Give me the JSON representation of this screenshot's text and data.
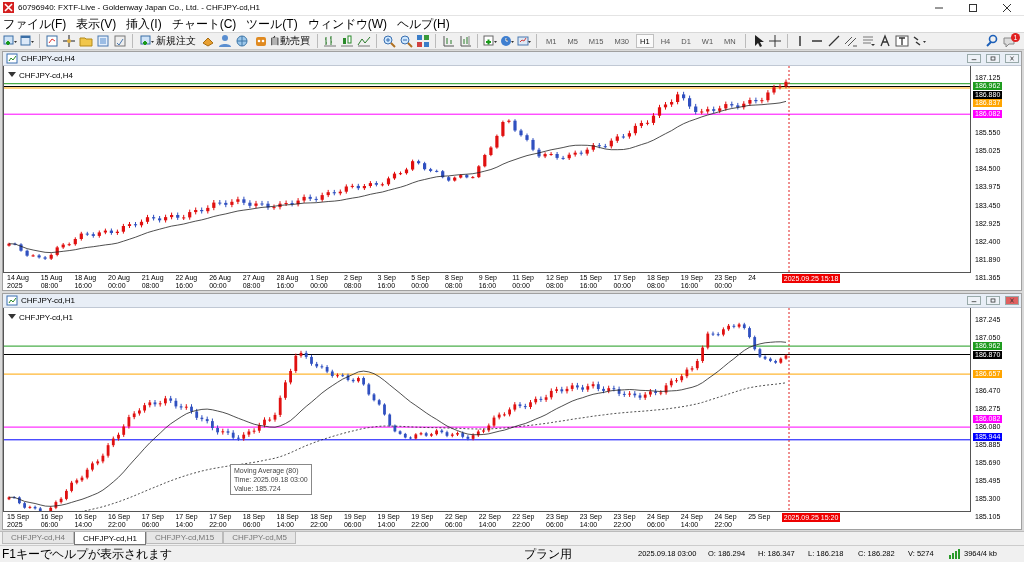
{
  "window": {
    "title": "60796940: FXTF-Live - Goldenway Japan Co., Ltd. - CHFJPY-cd,H1"
  },
  "menu": [
    "ファイル(F)",
    "表示(V)",
    "挿入(I)",
    "チャート(C)",
    "ツール(T)",
    "ウィンドウ(W)",
    "ヘルプ(H)"
  ],
  "toolbar": {
    "order_button": "新規注文",
    "autotrade_button": "自動売買",
    "notification_count": "1",
    "timeframes": [
      {
        "label": "M1",
        "selected": false
      },
      {
        "label": "M5",
        "selected": false
      },
      {
        "label": "M15",
        "selected": false
      },
      {
        "label": "M30",
        "selected": false
      },
      {
        "label": "H1",
        "selected": true
      },
      {
        "label": "H4",
        "selected": false
      },
      {
        "label": "D1",
        "selected": false
      },
      {
        "label": "W1",
        "selected": false
      },
      {
        "label": "MN",
        "selected": false
      }
    ]
  },
  "charts": [
    {
      "title": "CHFJPY-cd,H4",
      "symbol_label": "CHFJPY-cd,H4",
      "price_ticks": [
        "187.125",
        "185.550",
        "185.025",
        "184.500",
        "183.975",
        "183.450",
        "182.925",
        "182.400",
        "181.890",
        "181.365"
      ],
      "price_tags": [
        {
          "text": "186.962",
          "color": "#1e9b1e"
        },
        {
          "text": "186.880",
          "color": "#000000"
        },
        {
          "text": "186.837",
          "color": "#ffa500"
        },
        {
          "text": "186.082",
          "color": "#ff00ff"
        }
      ],
      "time_labels": [
        "14 Aug 2025",
        "15 Aug 08:00",
        "18 Aug 16:00",
        "20 Aug 00:00",
        "21 Aug 08:00",
        "22 Aug 16:00",
        "26 Aug 00:00",
        "27 Aug 08:00",
        "28 Aug 16:00",
        "1 Sep 00:00",
        "2 Sep 08:00",
        "3 Sep 16:00",
        "5 Sep 00:00",
        "8 Sep 08:00",
        "9 Sep 16:00",
        "11 Sep 00:00",
        "12 Sep 08:00",
        "15 Sep 16:00",
        "17 Sep 00:00",
        "18 Sep 08:00",
        "19 Sep 16:00",
        "23 Sep 00:00",
        "24"
      ],
      "time_marker": "2025.09.25 15:18"
    },
    {
      "title": "CHFJPY-cd,H1",
      "symbol_label": "CHFJPY-cd,H1",
      "price_ticks": [
        "187.245",
        "187.050",
        "186.470",
        "186.275",
        "186.080",
        "185.885",
        "185.690",
        "185.495",
        "185.300",
        "185.105"
      ],
      "price_tags": [
        {
          "text": "186.962",
          "color": "#1e9b1e"
        },
        {
          "text": "186.870",
          "color": "#000000"
        },
        {
          "text": "186.657",
          "color": "#ffa500"
        },
        {
          "text": "186.082",
          "color": "#ff00ff"
        },
        {
          "text": "185.944",
          "color": "#0000ff"
        }
      ],
      "time_labels": [
        "15 Sep 2025",
        "16 Sep 06:00",
        "16 Sep 14:00",
        "16 Sep 22:00",
        "17 Sep 06:00",
        "17 Sep 14:00",
        "17 Sep 22:00",
        "18 Sep 06:00",
        "18 Sep 14:00",
        "18 Sep 22:00",
        "19 Sep 06:00",
        "19 Sep 14:00",
        "19 Sep 22:00",
        "22 Sep 06:00",
        "22 Sep 14:00",
        "22 Sep 22:00",
        "23 Sep 06:00",
        "23 Sep 14:00",
        "23 Sep 22:00",
        "24 Sep 06:00",
        "24 Sep 14:00",
        "24 Sep 22:00",
        "25 Sep"
      ],
      "time_marker": "2025.09.25 15:20",
      "tooltip": [
        "Moving Average (80)",
        "Time: 2025.09.18 03:00",
        "Value: 185.724"
      ]
    }
  ],
  "tabs": [
    {
      "label": "CHFJPY-cd,H4",
      "selected": false
    },
    {
      "label": "CHFJPY-cd,H1",
      "selected": true
    },
    {
      "label": "CHFJPY-cd,M15",
      "selected": false
    },
    {
      "label": "CHFJPY-cd,M5",
      "selected": false
    }
  ],
  "status_bar": {
    "help": "F1キーでヘルプが表示されます",
    "profile": "プラン用",
    "time": "2025.09.18 03:00",
    "open": "O: 186.294",
    "high": "H: 186.347",
    "low": "L: 186.218",
    "close": "C: 186.282",
    "volume": "V: 5274",
    "traffic": "3964/4 kb"
  }
}
